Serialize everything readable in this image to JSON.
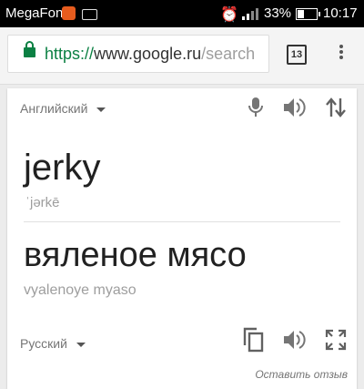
{
  "status_bar": {
    "carrier": "MegaFon",
    "battery_percent": "33%",
    "battery_level": 0.33,
    "time": "10:17"
  },
  "browser": {
    "url_scheme": "https://",
    "url_host": "www.google.ru",
    "url_path": "/search",
    "tab_count": "13"
  },
  "translate": {
    "source_language": "Английский",
    "source_word": "jerky",
    "phonetic": "ˈjərkē",
    "translation": "вяленое мясо",
    "transliteration": "vyalenoye myaso",
    "target_language": "Русский",
    "feedback_link": "Оставить отзыв"
  },
  "colors": {
    "secure_green": "#0b8043",
    "icon_gray": "#555555"
  },
  "icons": [
    "microphone-icon",
    "speaker-icon",
    "swap-languages-icon",
    "copy-icon",
    "fullscreen-icon",
    "lock-icon",
    "overflow-menu-icon"
  ]
}
